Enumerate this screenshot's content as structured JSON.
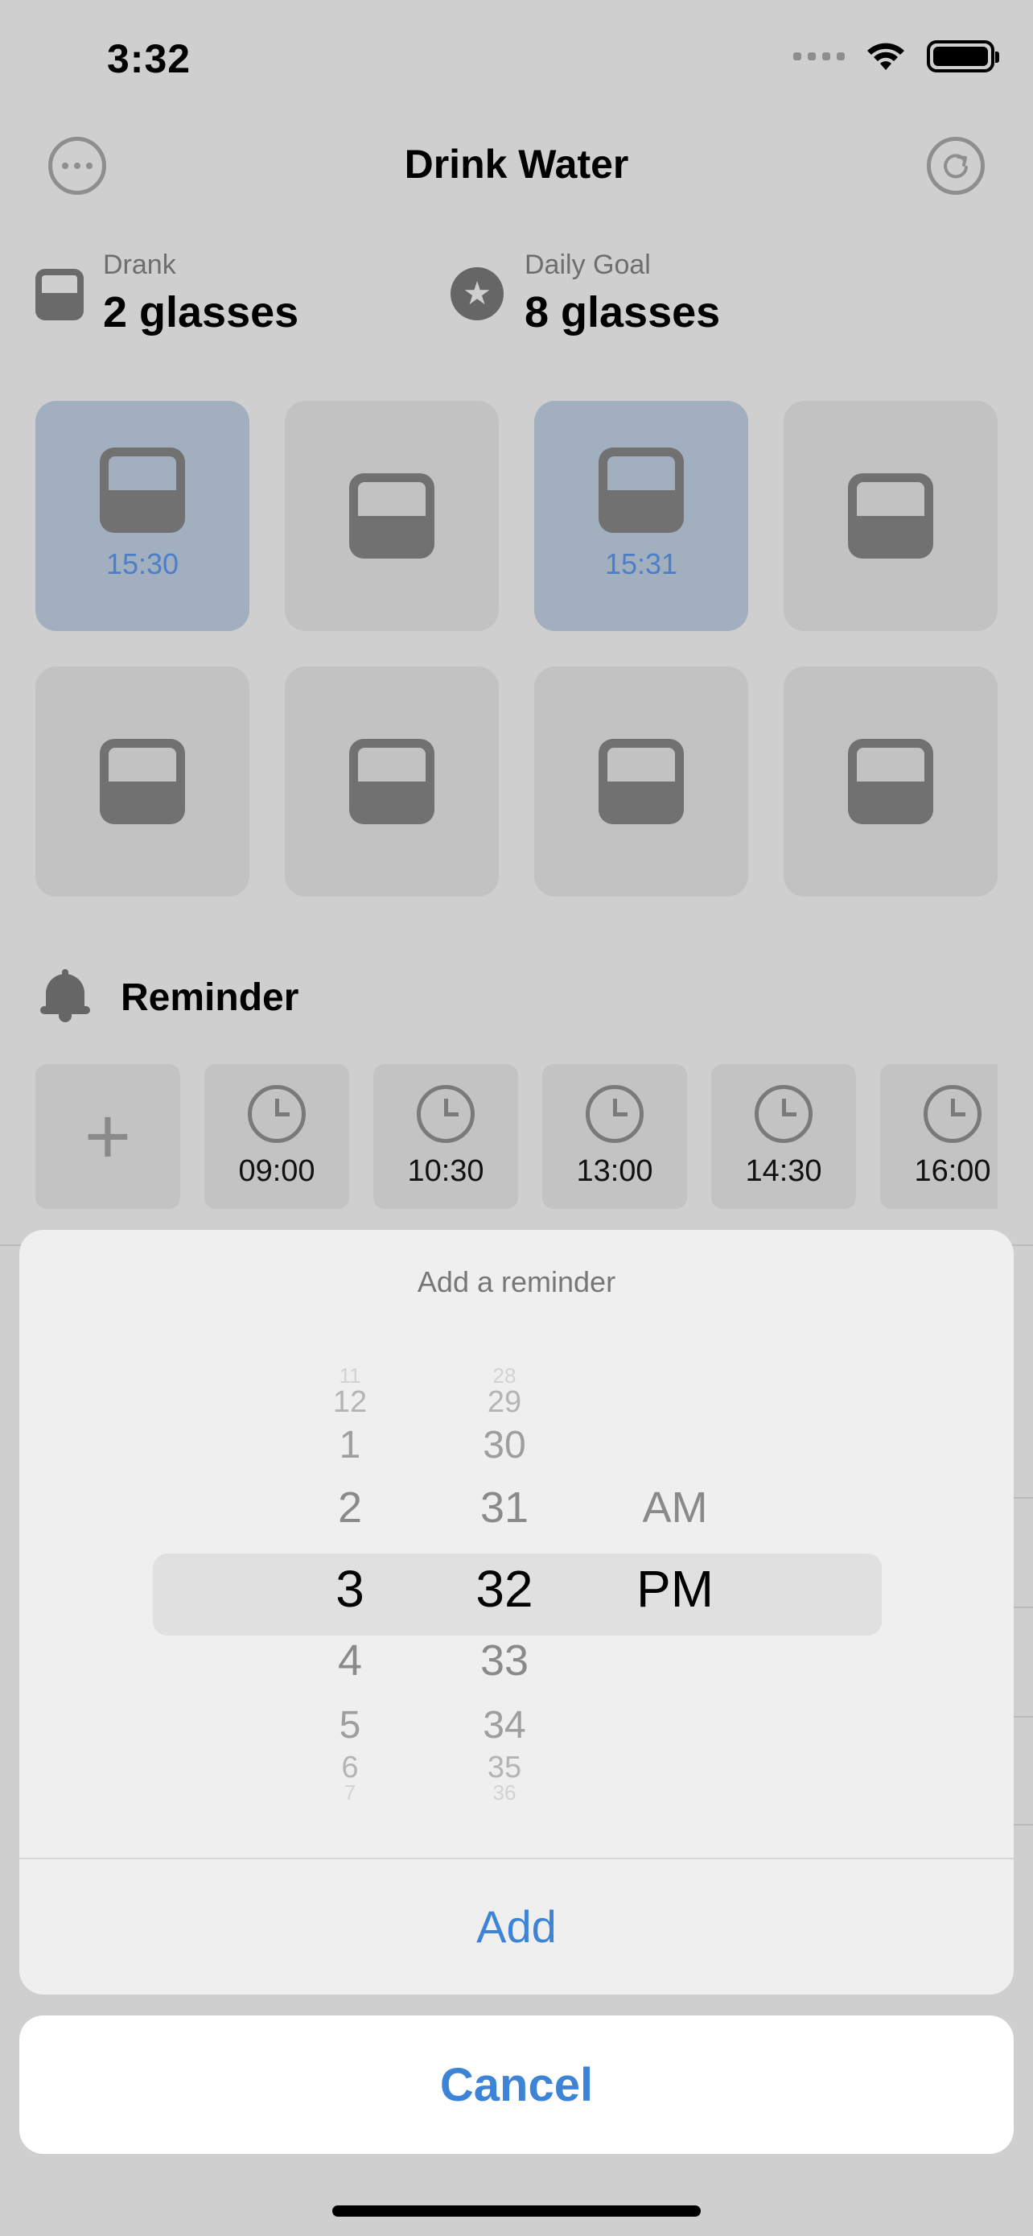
{
  "status_bar": {
    "time": "3:32"
  },
  "header": {
    "title": "Drink Water",
    "more_icon": "ellipsis-circle-icon",
    "reset_icon": "arrow-clockwise-icon"
  },
  "stats": {
    "drank": {
      "label": "Drank",
      "value": "2 glasses"
    },
    "goal": {
      "label": "Daily Goal",
      "value": "8 glasses"
    }
  },
  "glasses": [
    {
      "filled": true,
      "time": "15:30"
    },
    {
      "filled": false,
      "time": ""
    },
    {
      "filled": true,
      "time": "15:31"
    },
    {
      "filled": false,
      "time": ""
    },
    {
      "filled": false,
      "time": ""
    },
    {
      "filled": false,
      "time": ""
    },
    {
      "filled": false,
      "time": ""
    },
    {
      "filled": false,
      "time": ""
    }
  ],
  "reminder": {
    "title": "Reminder",
    "times": [
      "09:00",
      "10:30",
      "13:00",
      "14:30",
      "16:00"
    ]
  },
  "sheet": {
    "title": "Add a reminder",
    "hours": [
      "11",
      "12",
      "1",
      "2",
      "3",
      "4",
      "5",
      "6",
      "7"
    ],
    "minutes": [
      "28",
      "29",
      "30",
      "31",
      "32",
      "33",
      "34",
      "35",
      "36"
    ],
    "periods": [
      "AM",
      "PM"
    ],
    "selected": {
      "hour": "3",
      "minute": "32",
      "period": "PM"
    },
    "add_label": "Add",
    "cancel_label": "Cancel"
  },
  "colors": {
    "accent": "#3e84d6",
    "filled_tile": "#a2afbf",
    "empty_tile": "#c2c2c2"
  }
}
